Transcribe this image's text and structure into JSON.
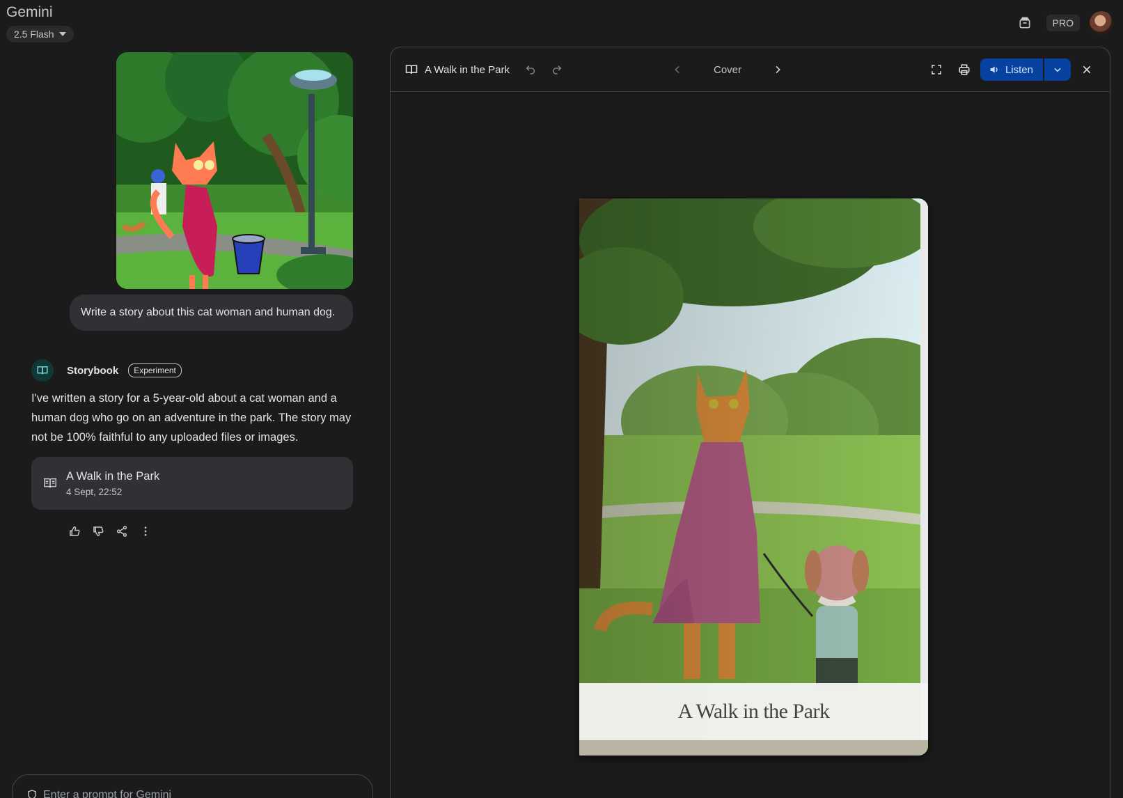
{
  "header": {
    "brand": "Gemini",
    "model": "2.5 Flash",
    "pro_label": "PRO"
  },
  "chat": {
    "user_prompt": "Write a story about this cat woman and human dog.",
    "bot": {
      "name": "Storybook",
      "badge": "Experiment",
      "message": "I've written a story for a 5-year-old about a cat woman and a human dog who go on an adventure in the park. The story may not be 100% faithful to any uploaded files or images."
    },
    "story_card": {
      "title": "A Walk in the Park",
      "timestamp": "4 Sept, 22:52"
    },
    "prompt_placeholder": "Enter a prompt for Gemini"
  },
  "viewer": {
    "title": "A Walk in the Park",
    "page_label": "Cover",
    "listen_label": "Listen",
    "book_cover_title": "A Walk in the Park"
  },
  "icons": {
    "brand_accent": "#0842a0",
    "storybook_icon": "book-open-icon"
  }
}
